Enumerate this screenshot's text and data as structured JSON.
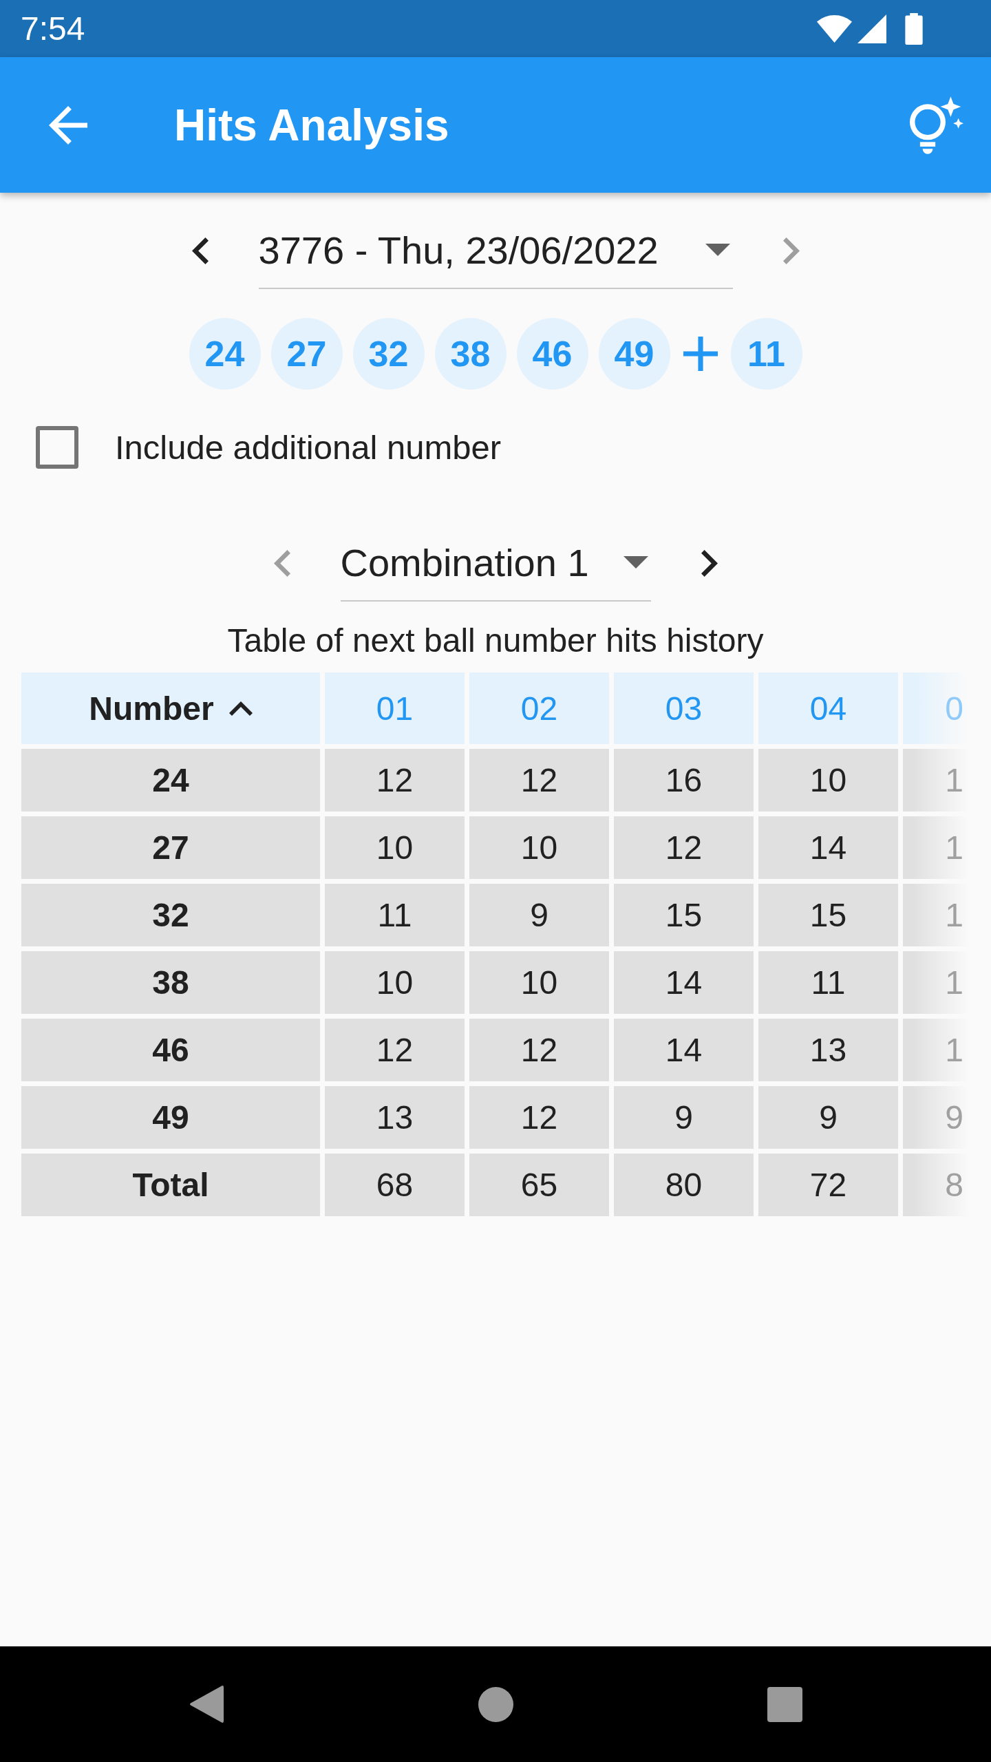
{
  "status_bar": {
    "time": "7:54"
  },
  "app_bar": {
    "title": "Hits Analysis"
  },
  "draw_selector": {
    "value": "3776 - Thu, 23/06/2022",
    "previous_disabled": false,
    "next_disabled": true
  },
  "winning_numbers": {
    "main": [
      "24",
      "27",
      "32",
      "38",
      "46",
      "49"
    ],
    "additional": "11"
  },
  "include_additional": {
    "label": "Include additional number",
    "checked": false
  },
  "combination_selector": {
    "value": "Combination 1",
    "previous_disabled": true,
    "next_disabled": false
  },
  "table": {
    "caption": "Table of next ball number hits history",
    "key_column": {
      "label": "Number",
      "sorted_ascending": true
    },
    "columns": [
      {
        "label": "01",
        "faded": false
      },
      {
        "label": "02",
        "faded": false
      },
      {
        "label": "03",
        "faded": false
      },
      {
        "label": "04",
        "faded": false
      },
      {
        "label": "0",
        "faded": true
      }
    ],
    "rows": [
      {
        "label": "24",
        "values": [
          "12",
          "12",
          "16",
          "10",
          "1"
        ]
      },
      {
        "label": "27",
        "values": [
          "10",
          "10",
          "12",
          "14",
          "1"
        ]
      },
      {
        "label": "32",
        "values": [
          "11",
          "9",
          "15",
          "15",
          "1"
        ]
      },
      {
        "label": "38",
        "values": [
          "10",
          "10",
          "14",
          "11",
          "1"
        ]
      },
      {
        "label": "46",
        "values": [
          "12",
          "12",
          "14",
          "13",
          "1"
        ]
      },
      {
        "label": "49",
        "values": [
          "13",
          "12",
          "9",
          "9",
          "9"
        ]
      },
      {
        "label": "Total",
        "values": [
          "68",
          "65",
          "80",
          "72",
          "8"
        ]
      }
    ]
  }
}
